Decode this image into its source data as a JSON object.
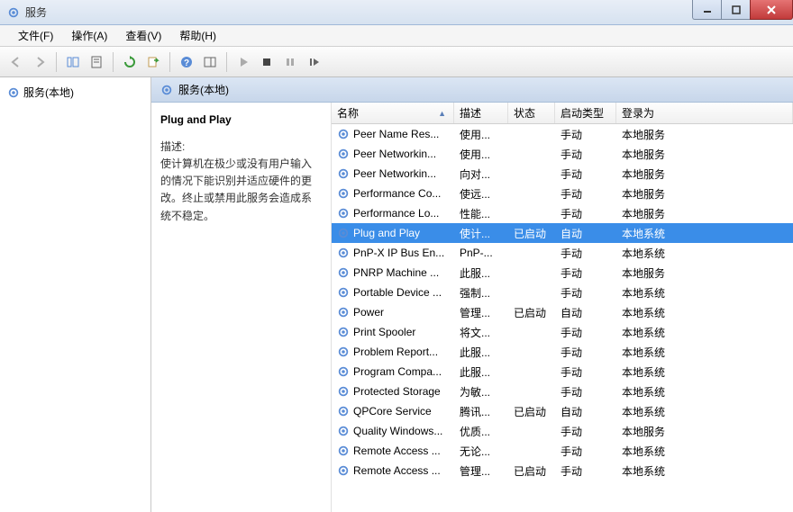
{
  "window": {
    "title": "服务"
  },
  "menu": {
    "file": "文件(F)",
    "action": "操作(A)",
    "view": "查看(V)",
    "help": "帮助(H)"
  },
  "left_tree": {
    "root": "服务(本地)"
  },
  "right_header": "服务(本地)",
  "detail": {
    "selected_name": "Plug and Play",
    "desc_label": "描述:",
    "desc_text": "使计算机在极少或没有用户输入的情况下能识别并适应硬件的更改。终止或禁用此服务会造成系统不稳定。"
  },
  "columns": {
    "name": "名称",
    "desc": "描述",
    "status": "状态",
    "startup": "启动类型",
    "logon": "登录为"
  },
  "services": [
    {
      "name": "Peer Name Res...",
      "desc": "使用...",
      "status": "",
      "startup": "手动",
      "logon": "本地服务"
    },
    {
      "name": "Peer Networkin...",
      "desc": "使用...",
      "status": "",
      "startup": "手动",
      "logon": "本地服务"
    },
    {
      "name": "Peer Networkin...",
      "desc": "向对...",
      "status": "",
      "startup": "手动",
      "logon": "本地服务"
    },
    {
      "name": "Performance Co...",
      "desc": "使远...",
      "status": "",
      "startup": "手动",
      "logon": "本地服务"
    },
    {
      "name": "Performance Lo...",
      "desc": "性能...",
      "status": "",
      "startup": "手动",
      "logon": "本地服务"
    },
    {
      "name": "Plug and Play",
      "desc": "使计...",
      "status": "已启动",
      "startup": "自动",
      "logon": "本地系统",
      "selected": true
    },
    {
      "name": "PnP-X IP Bus En...",
      "desc": "PnP-...",
      "status": "",
      "startup": "手动",
      "logon": "本地系统"
    },
    {
      "name": "PNRP Machine ...",
      "desc": "此服...",
      "status": "",
      "startup": "手动",
      "logon": "本地服务"
    },
    {
      "name": "Portable Device ...",
      "desc": "强制...",
      "status": "",
      "startup": "手动",
      "logon": "本地系统"
    },
    {
      "name": "Power",
      "desc": "管理...",
      "status": "已启动",
      "startup": "自动",
      "logon": "本地系统"
    },
    {
      "name": "Print Spooler",
      "desc": "将文...",
      "status": "",
      "startup": "手动",
      "logon": "本地系统"
    },
    {
      "name": "Problem Report...",
      "desc": "此服...",
      "status": "",
      "startup": "手动",
      "logon": "本地系统"
    },
    {
      "name": "Program Compa...",
      "desc": "此服...",
      "status": "",
      "startup": "手动",
      "logon": "本地系统"
    },
    {
      "name": "Protected Storage",
      "desc": "为敏...",
      "status": "",
      "startup": "手动",
      "logon": "本地系统"
    },
    {
      "name": "QPCore Service",
      "desc": "腾讯...",
      "status": "已启动",
      "startup": "自动",
      "logon": "本地系统"
    },
    {
      "name": "Quality Windows...",
      "desc": "优质...",
      "status": "",
      "startup": "手动",
      "logon": "本地服务"
    },
    {
      "name": "Remote Access ...",
      "desc": "无论...",
      "status": "",
      "startup": "手动",
      "logon": "本地系统"
    },
    {
      "name": "Remote Access ...",
      "desc": "管理...",
      "status": "已启动",
      "startup": "手动",
      "logon": "本地系统"
    }
  ]
}
